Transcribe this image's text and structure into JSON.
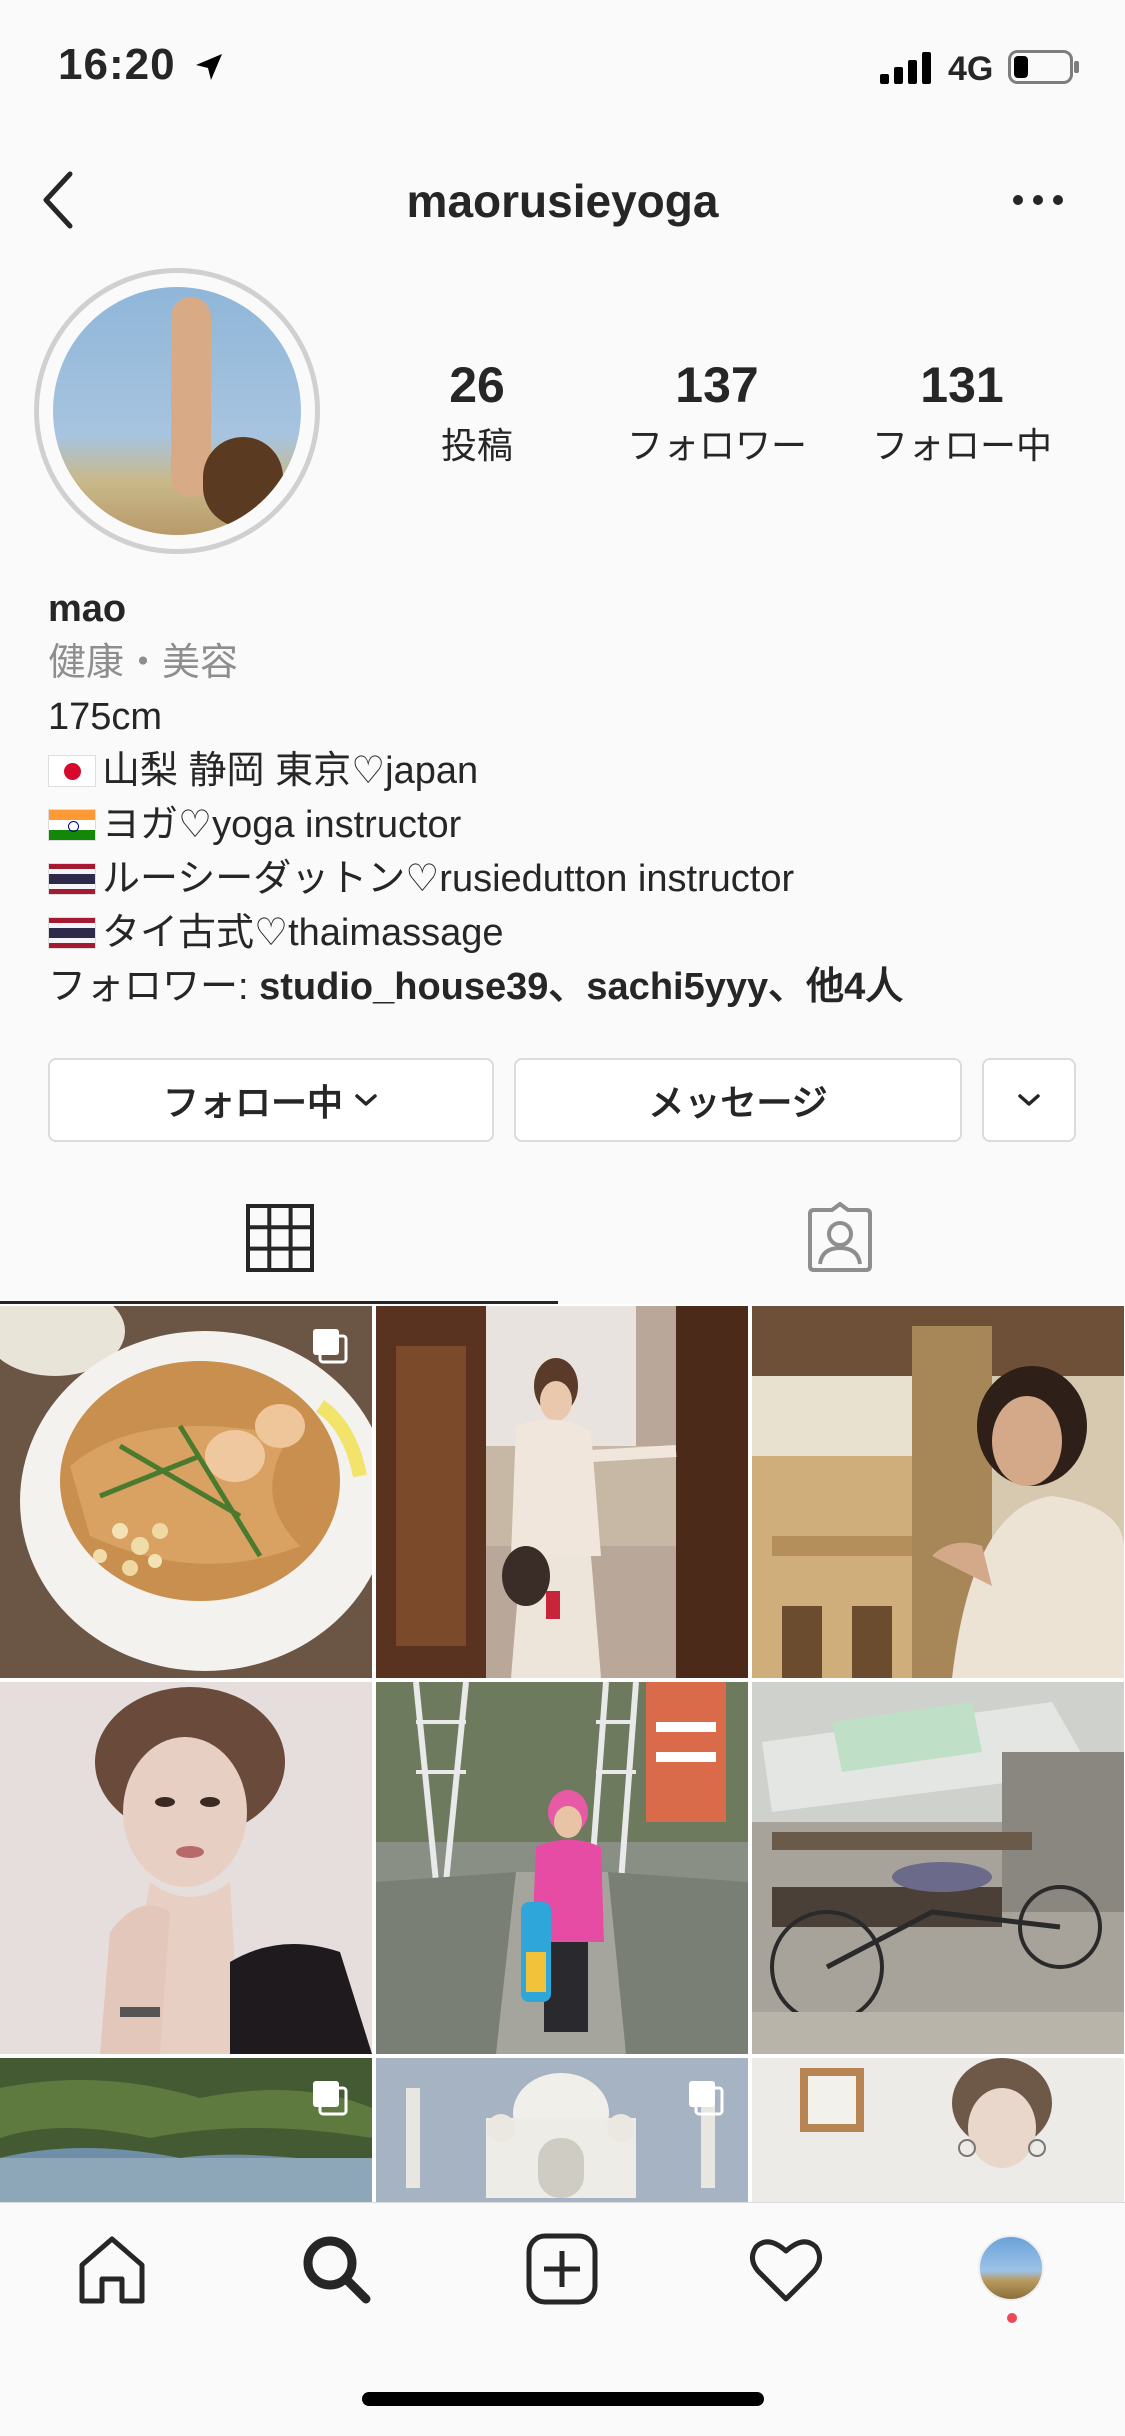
{
  "status_bar": {
    "time": "16:20",
    "network": "4G",
    "battery_icon": "battery-icon",
    "signal_icon": "signal-icon",
    "location_icon": "location-arrow-icon"
  },
  "header": {
    "username": "maorusieyoga",
    "back_icon": "chevron-left-icon",
    "more_icon": "more-horizontal-icon"
  },
  "profile": {
    "stats": [
      {
        "value": "26",
        "label": "投稿"
      },
      {
        "value": "137",
        "label": "フォロワー"
      },
      {
        "value": "131",
        "label": "フォロー中"
      }
    ],
    "name": "mao",
    "category": "健康・美容",
    "bio_lines": [
      "175cm",
      "山梨 静岡 東京♡japan",
      "ヨガ♡yoga instructor",
      "ルーシーダットン♡rusiedutton instructor",
      "タイ古式♡thaimassage"
    ],
    "followed_by_prefix": "フォロワー: ",
    "followed_by_names": "studio_house39、sachi5yyy、他4人"
  },
  "actions": {
    "follow_label": "フォロー中",
    "message_label": "メッセージ"
  },
  "tabs": [
    {
      "name": "grid-icon"
    },
    {
      "name": "tagged-user-icon"
    }
  ],
  "posts": [
    {
      "subject": "pad thai plate",
      "multi": true
    },
    {
      "subject": "woman in doorway",
      "multi": false
    },
    {
      "subject": "woman at fort",
      "multi": false
    },
    {
      "subject": "portrait",
      "multi": false
    },
    {
      "subject": "woman on bridge",
      "multi": false
    },
    {
      "subject": "rickshaw street",
      "multi": false
    },
    {
      "subject": "river forest",
      "multi": true
    },
    {
      "subject": "taj mahal",
      "multi": true
    },
    {
      "subject": "room with clock",
      "multi": false
    }
  ],
  "bottom_nav": [
    "home-icon",
    "search-icon",
    "new-post-icon",
    "activity-heart-icon",
    "profile-avatar"
  ],
  "colors": {
    "text": "#262626",
    "muted": "#8e8e8e",
    "border": "#dbdbdb",
    "background": "#fafafa",
    "notification": "#ed4956"
  }
}
